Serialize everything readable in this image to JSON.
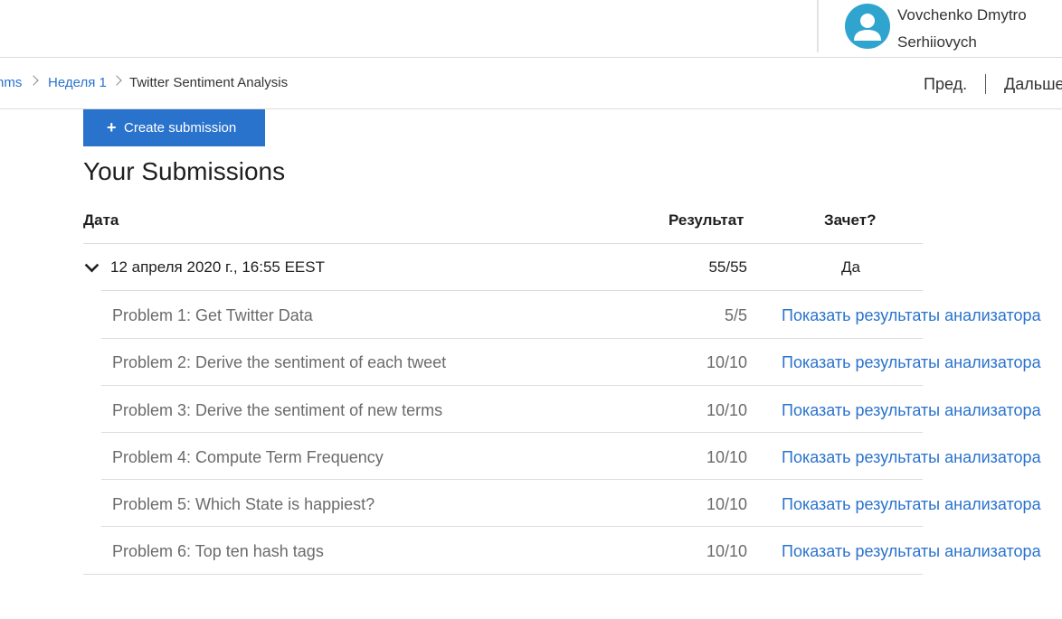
{
  "user": {
    "name": "Vovchenko Dmytro Serhiiovych"
  },
  "breadcrumb": {
    "items": [
      "nms",
      "Неделя 1"
    ],
    "current": "Twitter Sentiment Analysis"
  },
  "pager": {
    "prev": "Пред.",
    "next": "Дальше"
  },
  "actions": {
    "create_label": "Create submission"
  },
  "page_title": "Your Submissions",
  "table": {
    "headers": {
      "date": "Дата",
      "result": "Результат",
      "passed": "Зачет?"
    },
    "submission": {
      "date": "12 апреля 2020 г., 16:55 EEST",
      "score": "55/55",
      "passed": "Да"
    },
    "problems": [
      {
        "name": "Problem 1: Get Twitter Data",
        "score": "5/5",
        "link": "Показать результаты анализатора"
      },
      {
        "name": "Problem 2: Derive the sentiment of each tweet",
        "score": "10/10",
        "link": "Показать результаты анализатора"
      },
      {
        "name": "Problem 3: Derive the sentiment of new terms",
        "score": "10/10",
        "link": "Показать результаты анализатора"
      },
      {
        "name": "Problem 4: Compute Term Frequency",
        "score": "10/10",
        "link": "Показать результаты анализатора"
      },
      {
        "name": "Problem 5: Which State is happiest?",
        "score": "10/10",
        "link": "Показать результаты анализатора"
      },
      {
        "name": "Problem 6: Top ten hash tags",
        "score": "10/10",
        "link": "Показать результаты анализатора"
      }
    ]
  },
  "colors": {
    "accent": "#2a73cc",
    "avatar": "#2fa4cf",
    "muted_text": "#6b6b6b",
    "divider": "#dcdcdc"
  },
  "icons": [
    "user-avatar-icon",
    "chevron-right-icon",
    "plus-icon",
    "chevron-down-icon"
  ]
}
